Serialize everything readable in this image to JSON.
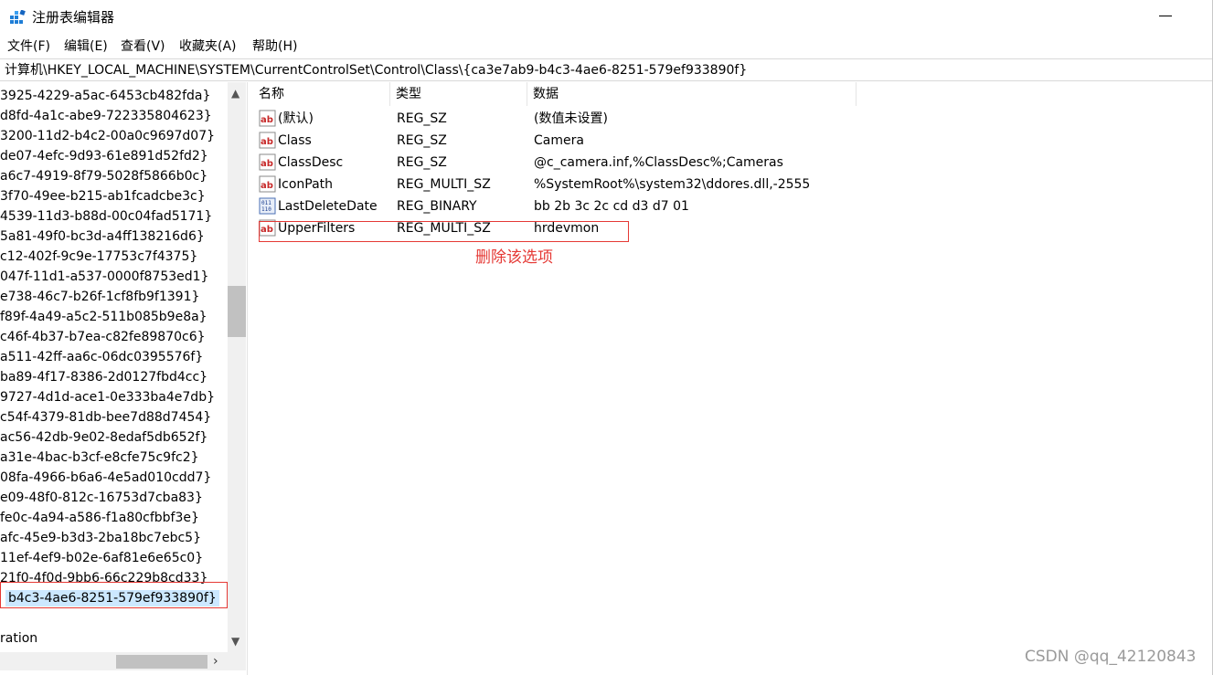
{
  "window": {
    "title": "注册表编辑器"
  },
  "menu": {
    "items": [
      "文件(F)",
      "编辑(E)",
      "查看(V)",
      "收藏夹(A)",
      "帮助(H)"
    ]
  },
  "address": {
    "path": "计算机\\HKEY_LOCAL_MACHINE\\SYSTEM\\CurrentControlSet\\Control\\Class\\{ca3e7ab9-b4c3-4ae6-8251-579ef933890f}"
  },
  "tree": {
    "items": [
      "3925-4229-a5ac-6453cb482fda}",
      "d8fd-4a1c-abe9-722335804623}",
      "3200-11d2-b4c2-00a0c9697d07}",
      "de07-4efc-9d93-61e891d52fd2}",
      "a6c7-4919-8f79-5028f5866b0c}",
      "3f70-49ee-b215-ab1fcadcbe3c}",
      "4539-11d3-b88d-00c04fad5171}",
      "5a81-49f0-bc3d-a4ff138216d6}",
      "c12-402f-9c9e-17753c7f4375}",
      "047f-11d1-a537-0000f8753ed1}",
      "e738-46c7-b26f-1cf8fb9f1391}",
      "f89f-4a49-a5c2-511b085b9e8a}",
      "c46f-4b37-b7ea-c82fe89870c6}",
      "a511-42ff-aa6c-06dc0395576f}",
      "ba89-4f17-8386-2d0127fbd4cc}",
      "9727-4d1d-ace1-0e333ba4e7db}",
      "c54f-4379-81db-bee7d88d7454}",
      "ac56-42db-9e02-8edaf5db652f}",
      "a31e-4bac-b3cf-e8cfe75c9fc2}",
      "08fa-4966-b6a6-4e5ad010cdd7}",
      "e09-48f0-812c-16753d7cba83}",
      "fe0c-4a94-a586-f1a80cfbbf3e}",
      "afc-45e9-b3d3-2ba18bc7ebc5}",
      "11ef-4ef9-b02e-6af81e6e65c0}",
      "21f0-4f0d-9bb6-66c229b8cd33}",
      "b4c3-4ae6-8251-579ef933890f}",
      "",
      "ration"
    ],
    "selected_index": 25
  },
  "columns": {
    "name": "名称",
    "type": "类型",
    "data": "数据"
  },
  "values": [
    {
      "icon": "string-value-icon",
      "name": "(默认)",
      "type": "REG_SZ",
      "data": "(数值未设置)"
    },
    {
      "icon": "string-value-icon",
      "name": "Class",
      "type": "REG_SZ",
      "data": "Camera"
    },
    {
      "icon": "string-value-icon",
      "name": "ClassDesc",
      "type": "REG_SZ",
      "data": "@c_camera.inf,%ClassDesc%;Cameras"
    },
    {
      "icon": "string-value-icon",
      "name": "IconPath",
      "type": "REG_MULTI_SZ",
      "data": "%SystemRoot%\\system32\\ddores.dll,-2555"
    },
    {
      "icon": "binary-value-icon",
      "name": "LastDeleteDate",
      "type": "REG_BINARY",
      "data": "bb 2b 3c 2c cd d3 d7 01"
    },
    {
      "icon": "string-value-icon",
      "name": "UpperFilters",
      "type": "REG_MULTI_SZ",
      "data": "hrdevmon"
    }
  ],
  "annotation": {
    "text": "删除该选项",
    "color": "#e53935"
  },
  "watermark": {
    "text": "CSDN @qq_42120843"
  },
  "colors": {
    "selection": "#cce8ff",
    "highlight_box": "#e53935",
    "scrollbar_thumb": "#c1c1c1"
  }
}
